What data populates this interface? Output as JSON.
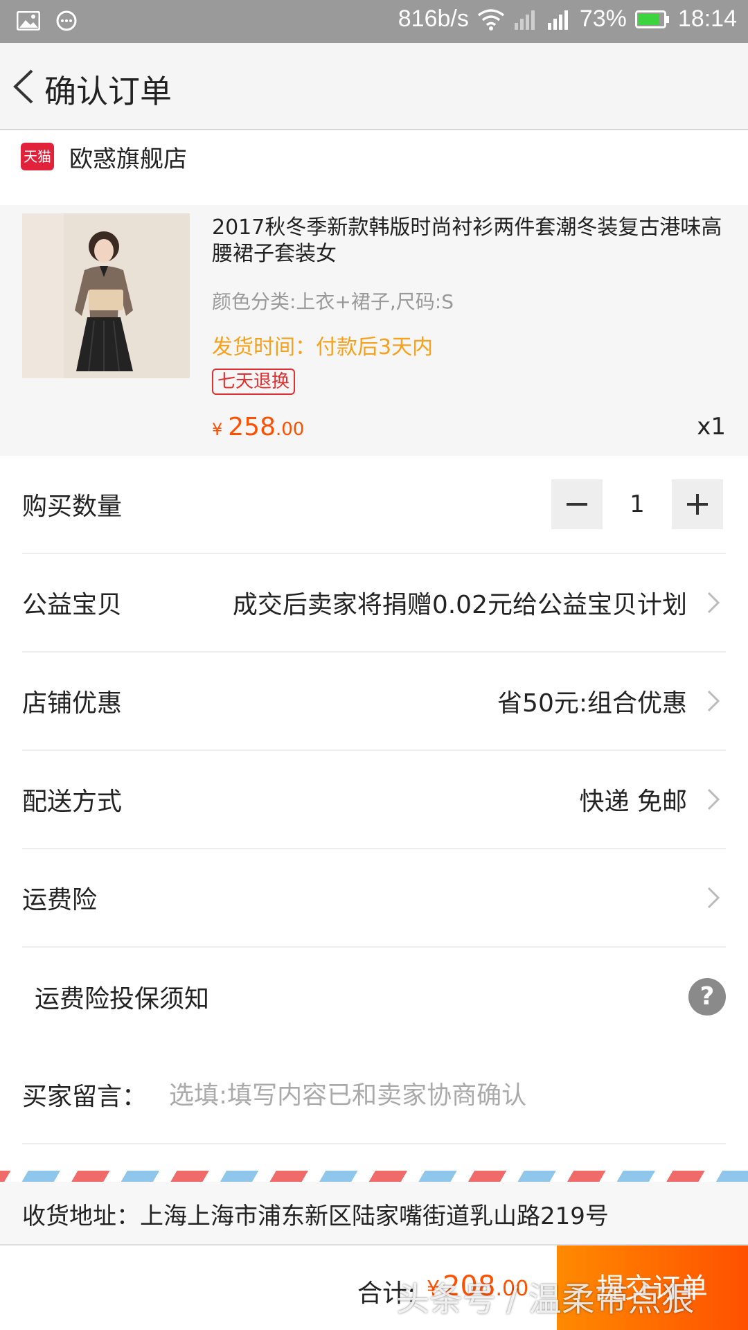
{
  "status_bar": {
    "speed": "816b/s",
    "battery": "73%",
    "time": "18:14"
  },
  "header": {
    "title": "确认订单"
  },
  "shop": {
    "logo_text": "天猫",
    "name": "欧惑旗舰店"
  },
  "product": {
    "title": "2017秋冬季新款韩版时尚衬衫两件套潮冬装复古港味高腰裙子套装女",
    "spec": "颜色分类:上衣+裙子,尺码:S",
    "ship_time": "发货时间：付款后3天内",
    "badge": "七天退换",
    "price_symbol": "¥",
    "price_integer": "258",
    "price_decimal": ".00",
    "quantity": "x1"
  },
  "rows": {
    "quantity_label": "购买数量",
    "quantity_value": "1",
    "charity_label": "公益宝贝",
    "charity_value": "成交后卖家将捐赠0.02元给公益宝贝计划",
    "discount_label": "店铺优惠",
    "discount_value": "省50元:组合优惠",
    "delivery_label": "配送方式",
    "delivery_value": "快递 免邮",
    "insurance_label": "运费险",
    "insurance_notice": "运费险投保须知"
  },
  "message": {
    "label": "买家留言：",
    "placeholder": "选填:填写内容已和卖家协商确认"
  },
  "address": {
    "label": "收货地址：",
    "value": "上海上海市浦东新区陆家嘴街道乳山路219号"
  },
  "footer": {
    "total_label": "合计:",
    "total_symbol": "¥",
    "total_integer": "208",
    "total_decimal": ".00",
    "submit_label": "提交订单"
  },
  "watermark": "头条号 / 温柔带点狠",
  "colors": {
    "accent": "#ff5000",
    "ship_time": "#f5a11b",
    "badge": "#e03030",
    "status_bar": "#9a9a9a"
  }
}
